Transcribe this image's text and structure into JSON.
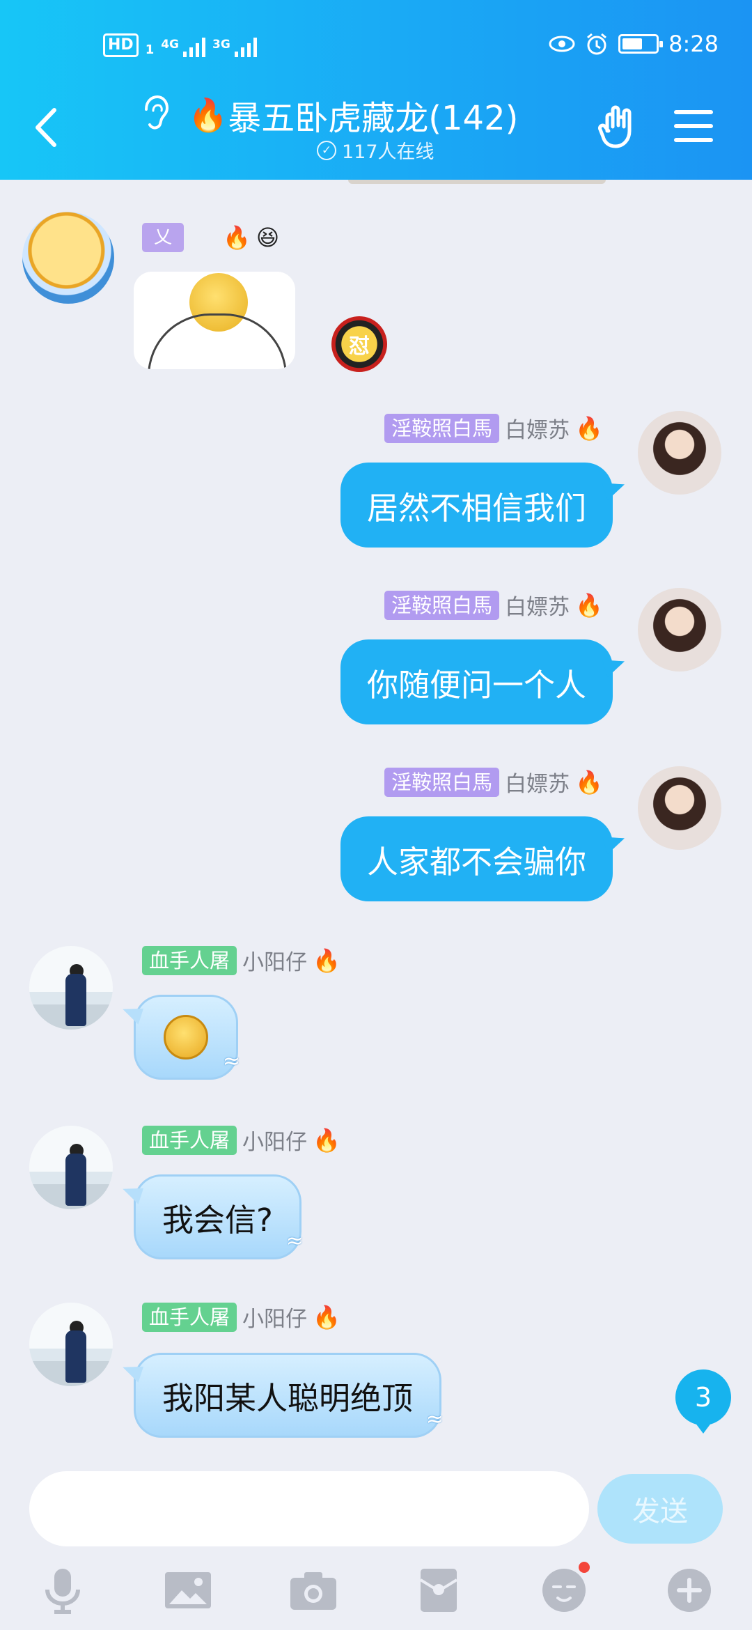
{
  "status_bar": {
    "hd": "HD",
    "hd_sub": "1",
    "net1": "4G",
    "net2": "3G",
    "time": "8:28",
    "battery_level": 0.6
  },
  "header": {
    "title": "暴五卧虎藏龙(142)",
    "online": "117人在线"
  },
  "messages": [
    {
      "badge": "乂",
      "nick": "",
      "type": "sticker"
    },
    {
      "badge": "淫鞍照白馬",
      "nick": "白嫖苏",
      "text": "居然不相信我们",
      "dir": "out"
    },
    {
      "badge": "淫鞍照白馬",
      "nick": "白嫖苏",
      "text": "你随便问一个人",
      "dir": "out"
    },
    {
      "badge": "淫鞍照白馬",
      "nick": "白嫖苏",
      "text": "人家都不会骗你",
      "dir": "out"
    },
    {
      "badge": "血手人屠",
      "nick": "小阳仔",
      "text": "",
      "dir": "in",
      "type": "emoji"
    },
    {
      "badge": "血手人屠",
      "nick": "小阳仔",
      "text": "我会信?",
      "dir": "in"
    },
    {
      "badge": "血手人屠",
      "nick": "小阳仔",
      "text": "我阳某人聪明绝顶",
      "dir": "in"
    }
  ],
  "sticker_badge_icon": "怼",
  "unread_count": "3",
  "input": {
    "placeholder": "",
    "send_label": "发送"
  },
  "toolbar": [
    "mic-icon",
    "image-icon",
    "camera-icon",
    "red-packet-icon",
    "emoji-icon",
    "plus-icon"
  ],
  "colors": {
    "header": "#1aa9f5",
    "out_bubble": "#21b1f4",
    "badge_purple": "#b19bf0",
    "badge_green": "#64d190"
  }
}
